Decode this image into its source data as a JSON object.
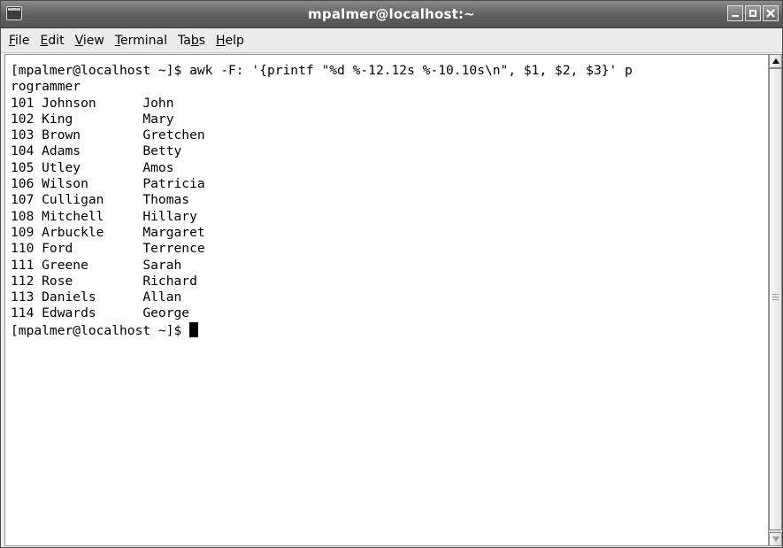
{
  "window": {
    "title": "mpalmer@localhost:~"
  },
  "menubar": {
    "items": [
      {
        "mnemonic": "F",
        "rest": "ile"
      },
      {
        "mnemonic": "E",
        "rest": "dit"
      },
      {
        "mnemonic": "V",
        "rest": "iew"
      },
      {
        "mnemonic": "T",
        "rest": "erminal"
      },
      {
        "pre": "Ta",
        "mnemonic": "b",
        "rest": "s"
      },
      {
        "mnemonic": "H",
        "rest": "elp"
      }
    ]
  },
  "terminal": {
    "lines": [
      "[mpalmer@localhost ~]$ awk -F: '{printf \"%d %-12.12s %-10.10s\\n\", $1, $2, $3}' p",
      "rogrammer",
      "101 Johnson      John",
      "102 King         Mary",
      "103 Brown        Gretchen",
      "104 Adams        Betty",
      "105 Utley        Amos",
      "106 Wilson       Patricia",
      "107 Culligan     Thomas",
      "108 Mitchell     Hillary",
      "109 Arbuckle     Margaret",
      "110 Ford         Terrence",
      "111 Greene       Sarah",
      "112 Rose         Richard",
      "113 Daniels      Allan",
      "114 Edwards      George"
    ],
    "prompt": "[mpalmer@localhost ~]$ "
  },
  "icons": {
    "app": "terminal-app-icon",
    "minimize": "minimize-icon",
    "maximize": "maximize-icon",
    "close": "close-icon",
    "scroll_up": "arrow-up-icon",
    "scroll_down": "arrow-down-icon"
  }
}
